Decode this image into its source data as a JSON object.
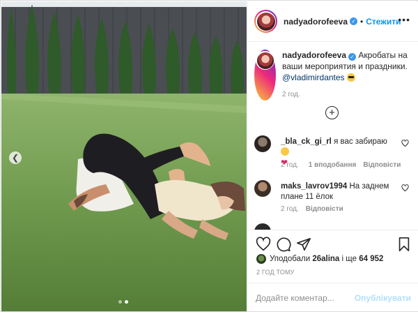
{
  "post": {
    "username": "nadyadorofeeva",
    "follow_label": "Стежити",
    "more_label": "•••",
    "caption_text": "Акробаты на ваши мероприятия и праздники.",
    "caption_mention": "@vladimirdantes",
    "caption_time": "2 год."
  },
  "comments": [
    {
      "username": "_bla_ck_gi_rl",
      "text": "я вас забираю",
      "time": "2 год.",
      "likes": "1 вподобання",
      "reply": "Відповісти"
    },
    {
      "username": "maks_lavrov1994",
      "text": "На заднем плане 11 ёлок",
      "time": "2 год.",
      "reply": "Відповісти"
    }
  ],
  "likes": {
    "prefix": "Уподобали",
    "user": "26alina",
    "middle": "і ще",
    "count": "64 952"
  },
  "post_time": "2 ГОД ТОМУ",
  "add_comment": {
    "placeholder": "Додайте коментар...",
    "publish_label": "Опублікувати"
  },
  "carousel": {
    "current": 2,
    "total": 2
  },
  "icons": {
    "verified": "verified-badge-icon",
    "load_more": "plus-circle-icon",
    "like": "heart-icon",
    "comment": "comment-icon",
    "share": "send-icon",
    "save": "bookmark-icon",
    "prev": "chevron-left-icon"
  },
  "colors": {
    "link": "#0095f6",
    "verified": "#3897f0",
    "publish_disabled": "#b2dffc",
    "meta": "#8e8e8e"
  }
}
